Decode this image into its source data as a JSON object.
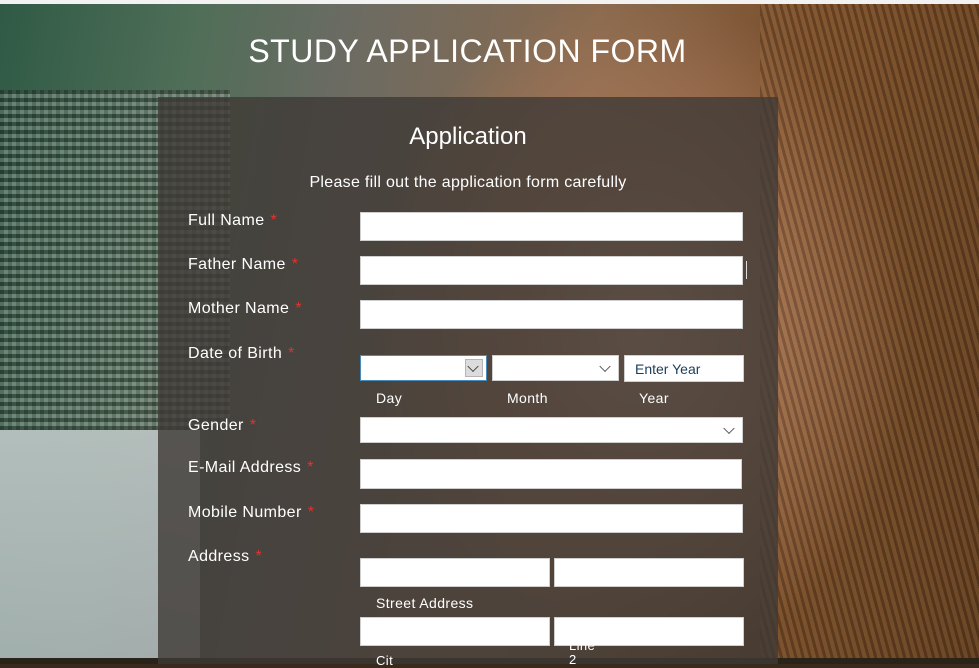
{
  "page": {
    "title": "STUDY APPLICATION FORM"
  },
  "form": {
    "title": "Application",
    "subtitle": "Please fill out the application form carefully",
    "required_marker": "*",
    "fields": {
      "full_name": {
        "label": "Full Name",
        "value": ""
      },
      "father_name": {
        "label": "Father Name",
        "value": ""
      },
      "mother_name": {
        "label": "Mother Name",
        "value": ""
      },
      "date_of_birth": {
        "label": "Date of Birth",
        "day": {
          "selected": "",
          "sublabel": "Day"
        },
        "month": {
          "selected": "",
          "sublabel": "Month"
        },
        "year": {
          "placeholder": "Enter Year",
          "sublabel": "Year"
        }
      },
      "gender": {
        "label": "Gender",
        "selected": ""
      },
      "email": {
        "label": "E-Mail Address",
        "value": ""
      },
      "mobile": {
        "label": "Mobile Number",
        "value": ""
      },
      "address": {
        "label": "Address",
        "street_sublabel": "Street Address",
        "city_sublabel_partial": "Cit",
        "line2_sublabel_partial": "Line\n2"
      }
    }
  },
  "colors": {
    "required": "#e0342f",
    "panel": "#3e3a36"
  }
}
